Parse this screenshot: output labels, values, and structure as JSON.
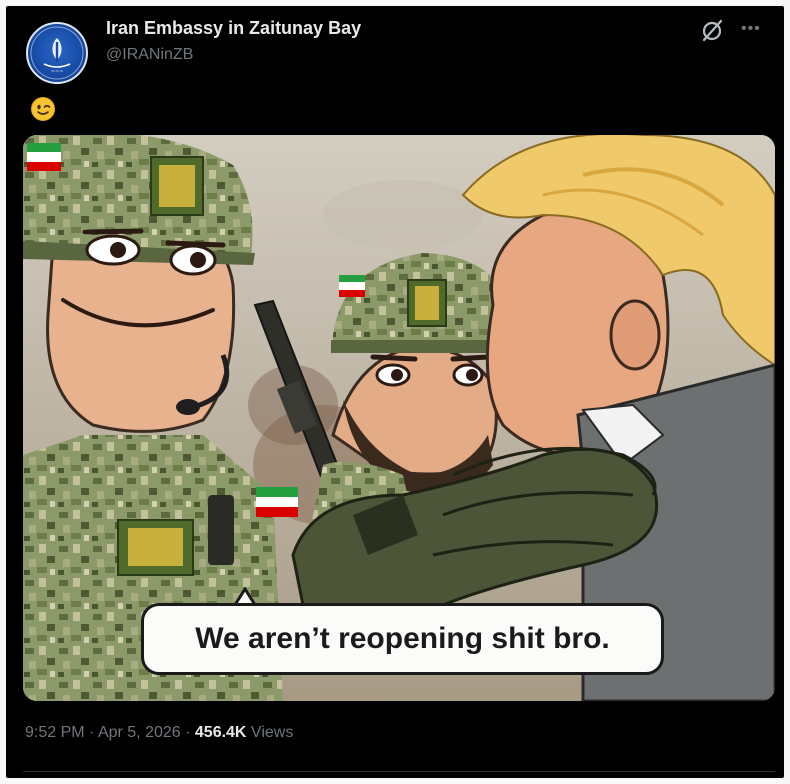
{
  "post": {
    "display_name": "Iran Embassy in Zaitunay Bay",
    "handle": "@IRANinZB",
    "emoji": "😉",
    "image_caption": "We aren’t reopening shit bro.",
    "time": "9:52 PM",
    "separator": " · ",
    "date": "Apr 5, 2026",
    "views_count": "456.4K",
    "views_label": " Views"
  },
  "icons": {
    "grok": "grok-icon",
    "more": "more-icon",
    "avatar": "embassy-emblem"
  },
  "colors": {
    "background": "#000000",
    "primary_text": "#e7e9ea",
    "secondary_text": "#71767b",
    "avatar_blue": "#164aa3"
  }
}
